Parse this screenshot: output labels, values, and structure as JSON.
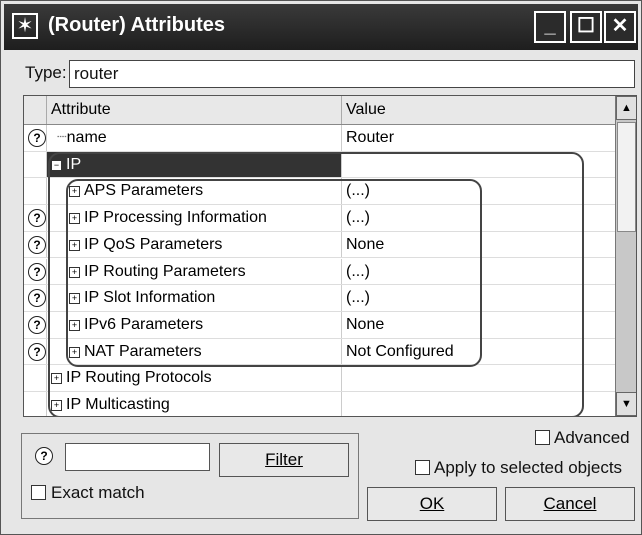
{
  "window": {
    "title": "(Router) Attributes",
    "minimize": "_",
    "maximize": "☐",
    "close": "✕",
    "app_icon": "✶"
  },
  "type": {
    "label": "Type:",
    "value": "router"
  },
  "grid": {
    "headers": {
      "attribute": "Attribute",
      "value": "Value"
    },
    "rows": [
      {
        "help": true,
        "attribute": "name",
        "value": "Router"
      },
      {
        "help": false,
        "attribute": "IP",
        "value": ""
      },
      {
        "help": false,
        "attribute": "APS Parameters",
        "value": "(...)"
      },
      {
        "help": true,
        "attribute": "IP Processing Information",
        "value": "(...)"
      },
      {
        "help": true,
        "attribute": "IP QoS Parameters",
        "value": "None"
      },
      {
        "help": true,
        "attribute": "IP Routing Parameters",
        "value": "(...)"
      },
      {
        "help": true,
        "attribute": "IP Slot Information",
        "value": "(...)"
      },
      {
        "help": true,
        "attribute": "IPv6 Parameters",
        "value": "None"
      },
      {
        "help": true,
        "attribute": "NAT Parameters",
        "value": "Not Configured"
      },
      {
        "help": false,
        "attribute": "IP Routing Protocols",
        "value": ""
      },
      {
        "help": false,
        "attribute": "IP Multicasting",
        "value": ""
      }
    ],
    "scroll_up": "▲",
    "scroll_down": "▼",
    "help_glyph": "?"
  },
  "filter": {
    "button": "Filter",
    "value": "",
    "exact_match": "Exact match"
  },
  "options": {
    "advanced": "Advanced",
    "apply": "Apply to selected objects"
  },
  "buttons": {
    "ok": "OK",
    "cancel": "Cancel"
  }
}
